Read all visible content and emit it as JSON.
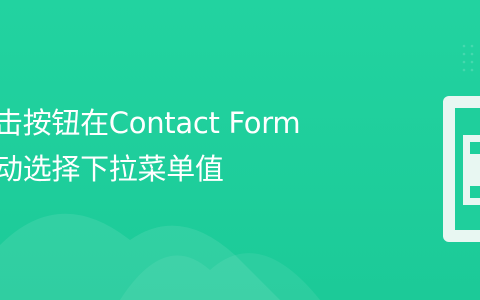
{
  "banner": {
    "headline_line1": "击按钮在Contact Form",
    "headline_line2": "动选择下拉菜单值",
    "colors": {
      "background": "#1fcf9c",
      "text": "#ffffff",
      "device_frame": "#e8f7f2"
    },
    "icons": [
      "device-frame-icon",
      "mountain-shape",
      "grid-dots"
    ]
  }
}
